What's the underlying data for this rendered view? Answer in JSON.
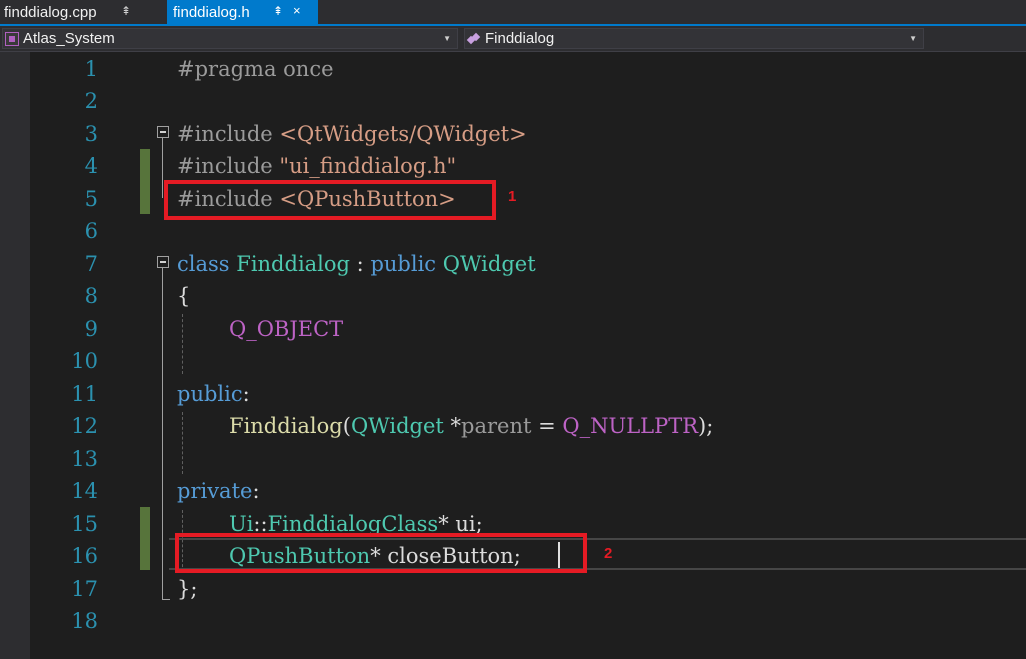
{
  "tabs": [
    {
      "label": "finddialog.cpp",
      "pin": "⇞"
    },
    {
      "label": "finddialog.h",
      "pin": "⇞",
      "close": "×"
    }
  ],
  "nav": {
    "project": "Atlas_System",
    "class": "Finddialog"
  },
  "lines": {
    "numbers": [
      "1",
      "2",
      "3",
      "4",
      "5",
      "6",
      "7",
      "8",
      "9",
      "10",
      "11",
      "12",
      "13",
      "14",
      "15",
      "16",
      "17",
      "18"
    ],
    "l1": {
      "directive": "#pragma",
      "rest": " once"
    },
    "l3": {
      "directive": "#include",
      "arg": "<QtWidgets/QWidget>"
    },
    "l4": {
      "directive": "#include",
      "arg": "\"ui_finddialog.h\""
    },
    "l5": {
      "directive": "#include",
      "arg": "<QPushButton>"
    },
    "l7": {
      "kw_class": "class",
      "name": "Finddialog",
      "colon": " : ",
      "kw_public": "public",
      "base": "QWidget"
    },
    "l8": "{",
    "l9": "Q_OBJECT",
    "l11": {
      "kw": "public",
      "colon": ":"
    },
    "l12": {
      "fn": "Finddialog",
      "open": "(",
      "type": "QWidget",
      "star": " *",
      "param": "parent",
      "eq": " = ",
      "macro": "Q_NULLPTR",
      "close": ");"
    },
    "l14": {
      "kw": "private",
      "colon": ":"
    },
    "l15": {
      "ns": "Ui",
      "sep": "::",
      "type": "FinddialogClass",
      "rest": "* ui;"
    },
    "l16": {
      "type": "QPushButton",
      "rest": "* closeButton;"
    },
    "l17": "};"
  },
  "annotations": [
    "1",
    "2"
  ],
  "colors": {
    "accent": "#007acc",
    "annotation": "#e51b24",
    "change_bar": "#57743b",
    "line_number": "#2b91af"
  },
  "icons": {
    "project": "project-icon",
    "class": "class-icon",
    "pin": "pin-icon",
    "close": "close-icon",
    "dropdown": "chevron-down-icon"
  }
}
